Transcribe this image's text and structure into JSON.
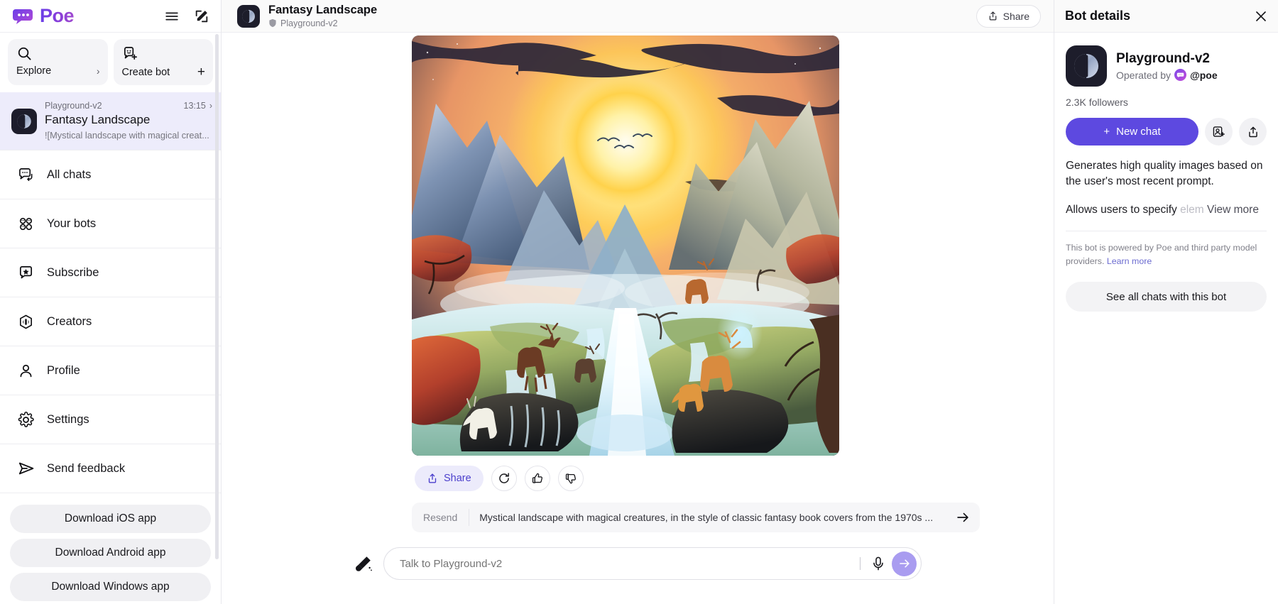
{
  "brand": {
    "name": "Poe",
    "accent": "#5d49e0"
  },
  "sidebar": {
    "header_icons": [
      "menu-icon",
      "compose-icon"
    ],
    "explore": {
      "label": "Explore",
      "icon": "search-icon",
      "chevron": "›"
    },
    "create_bot": {
      "label": "Create bot",
      "icon": "create-bot-icon",
      "plus": "+"
    },
    "chat_item": {
      "bot": "Playground-v2",
      "time": "13:15",
      "title": "Fantasy Landscape",
      "snippet": "![Mystical landscape with magical creat...",
      "chevron": "›"
    },
    "nav": [
      {
        "label": "All chats",
        "icon": "chats-icon"
      },
      {
        "label": "Your bots",
        "icon": "bots-grid-icon"
      },
      {
        "label": "Subscribe",
        "icon": "star-badge-icon"
      },
      {
        "label": "Creators",
        "icon": "creators-cube-icon"
      },
      {
        "label": "Profile",
        "icon": "person-icon"
      },
      {
        "label": "Settings",
        "icon": "gear-icon"
      },
      {
        "label": "Send feedback",
        "icon": "send-plane-icon"
      }
    ],
    "downloads": [
      {
        "label": "Download iOS app"
      },
      {
        "label": "Download Android app"
      },
      {
        "label": "Download Windows app"
      }
    ]
  },
  "main": {
    "header": {
      "title": "Fantasy Landscape",
      "bot": "Playground-v2",
      "shield_icon": "shield-icon",
      "share_label": "Share",
      "share_icon": "share-upload-icon"
    },
    "message": {
      "image_alt": "Mystical fantasy landscape with mountains, glowing sun, river and deer",
      "actions": {
        "share_label": "Share",
        "share_icon": "share-upload-icon",
        "retry_icon": "refresh-icon",
        "like_icon": "thumb-up-icon",
        "dislike_icon": "thumb-down-icon"
      }
    },
    "resend": {
      "label": "Resend",
      "prompt": "Mystical landscape with magical creatures, in the style of classic fantasy book covers from the 1970s ...",
      "arrow_icon": "arrow-right-icon"
    },
    "composer": {
      "brush_icon": "paintbrush-icon",
      "placeholder": "Talk to Playground-v2",
      "mic_icon": "microphone-icon",
      "send_icon": "arrow-right-icon"
    }
  },
  "details": {
    "title": "Bot details",
    "close_icon": "close-icon",
    "bot_name": "Playground-v2",
    "operated_by_prefix": "Operated by",
    "operator_handle": "@poe",
    "followers": "2.3K followers",
    "new_chat_label": "New chat",
    "new_chat_plus": "+",
    "icon_buttons": [
      "add-person-icon",
      "share-upload-icon"
    ],
    "description": "Generates high quality images based on the user's most recent prompt.",
    "description2_visible": "Allows users to specify ",
    "description2_faded": "elem",
    "view_more_label": "View more",
    "powered_note": "This bot is powered by Poe and third party model providers.",
    "learn_more_label": "Learn more",
    "see_all_label": "See all chats with this bot"
  }
}
